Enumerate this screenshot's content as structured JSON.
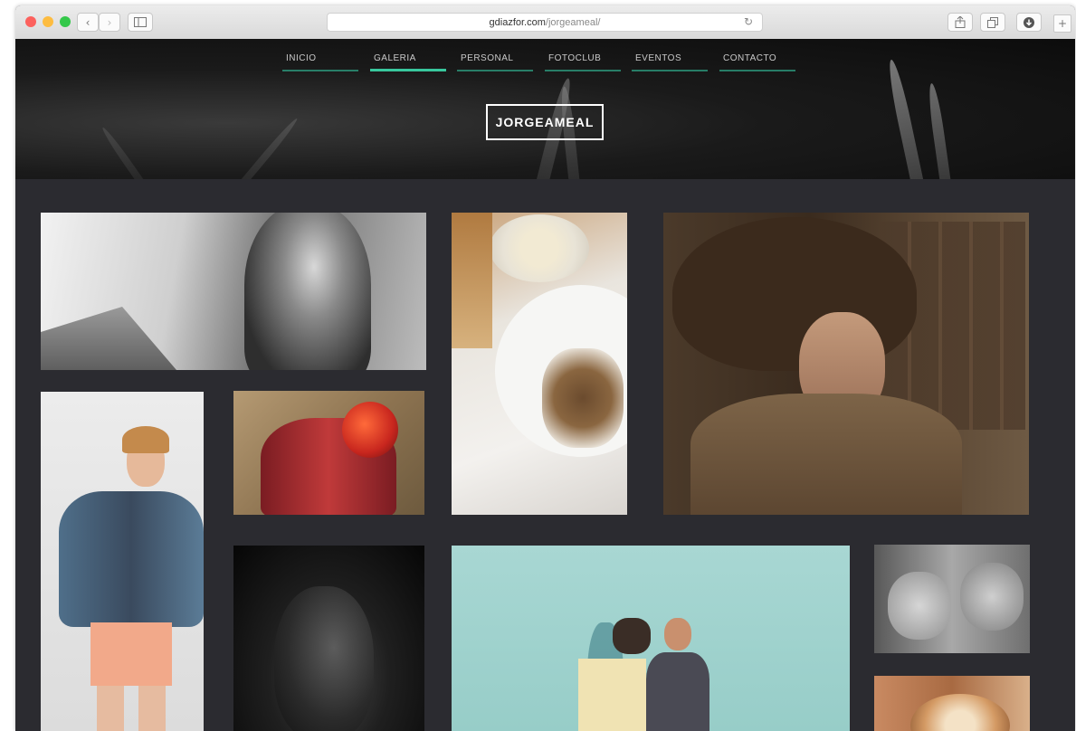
{
  "browser": {
    "url_domain": "gdiazfor.com",
    "url_path": "/jorgeameal/"
  },
  "nav": {
    "items": [
      {
        "label": "INICIO"
      },
      {
        "label": "GALERIA",
        "active": true
      },
      {
        "label": "PERSONAL"
      },
      {
        "label": "FOTOCLUB"
      },
      {
        "label": "EVENTOS"
      },
      {
        "label": "CONTACTO"
      }
    ]
  },
  "logo": {
    "text": "JORGEAMEAL"
  },
  "colors": {
    "accent": "#38c79d",
    "page_background": "#2b2b30"
  },
  "gallery": {
    "photos": [
      {
        "subject": "woman-hair-portrait"
      },
      {
        "subject": "food-plate"
      },
      {
        "subject": "woman-in-hat"
      },
      {
        "subject": "woman-denim-jacket"
      },
      {
        "subject": "motocross-rider"
      },
      {
        "subject": "man-portrait-dark"
      },
      {
        "subject": "couple-on-blue"
      },
      {
        "subject": "couple-lying"
      },
      {
        "subject": "latte-art"
      }
    ]
  }
}
